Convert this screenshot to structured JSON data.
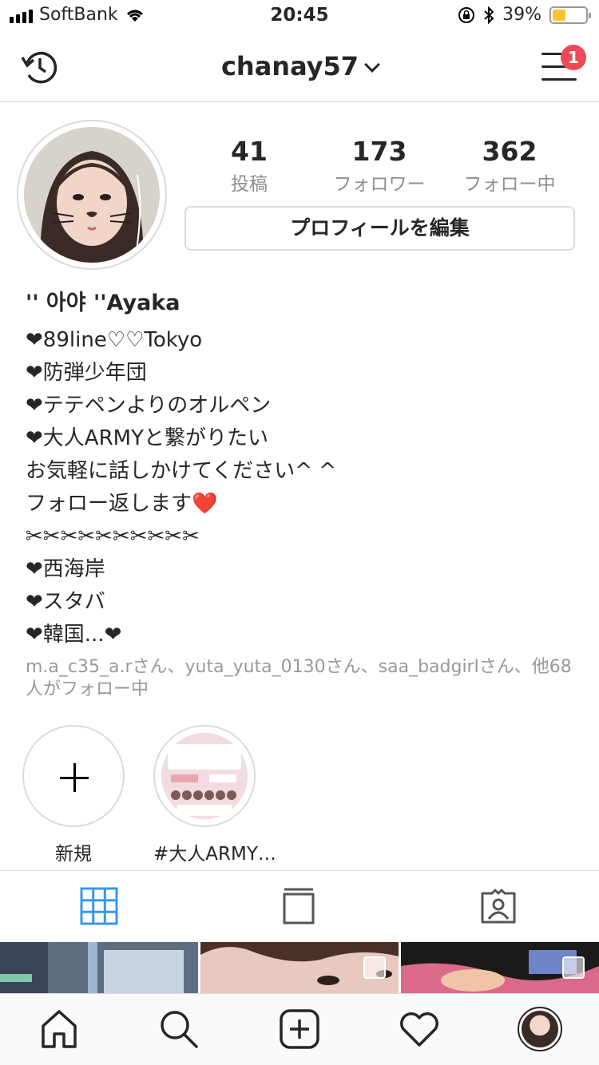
{
  "status_bar": {
    "carrier": "SoftBank",
    "time": "20:45",
    "battery_percent": "39%",
    "battery_level": 0.39
  },
  "header": {
    "username": "chanay57",
    "notification_count": "1"
  },
  "profile": {
    "stats": [
      {
        "number": "41",
        "label": "投稿"
      },
      {
        "number": "173",
        "label": "フォロワー"
      },
      {
        "number": "362",
        "label": "フォロー中"
      }
    ],
    "edit_button": "プロフィールを編集",
    "name": "'' 아야 ''Ayaka",
    "bio_lines": [
      "❤89line♡♡Tokyo",
      "❤防弾少年団",
      "❤テテペンよりのオルペン",
      "❤大人ARMYと繋がりたい",
      "お気軽に話しかけてください^ ^",
      "フォロー返します❤️",
      "✂✂✂✂✂✂✂✂✂✂",
      "❤西海岸",
      "❤スタバ",
      "❤韓国...❤"
    ],
    "followed_by": "m.a_c35_a.rさん、yuta_yuta_0130さん、saa_badgirlさん、他68人がフォロー中"
  },
  "highlights": [
    {
      "label": "新規"
    },
    {
      "label": "#大人ARMY…"
    }
  ],
  "colors": {
    "accent_blue": "#3897f0",
    "badge_red": "#ed4956",
    "muted_text": "#8e8e8e",
    "border": "#dbdbdb"
  }
}
